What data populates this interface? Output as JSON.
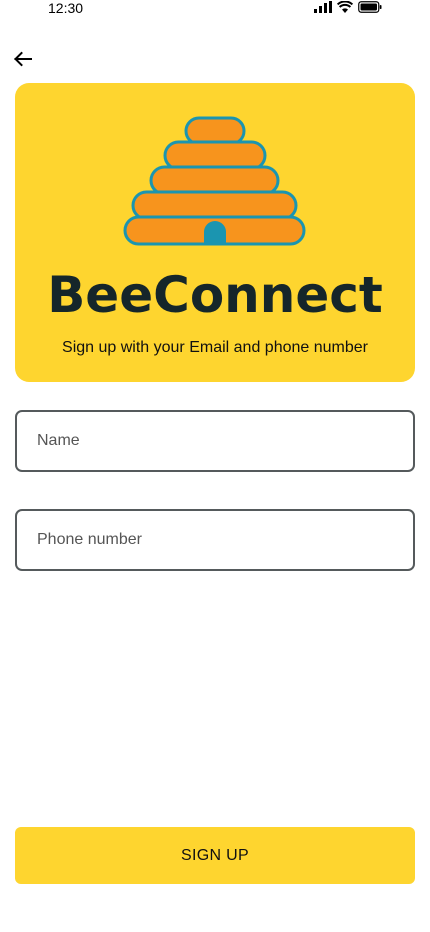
{
  "status_bar": {
    "time": "12:30",
    "icons": [
      "signal-icon",
      "wifi-icon",
      "battery-icon"
    ]
  },
  "nav": {
    "back_icon": "arrow-left-icon"
  },
  "hero": {
    "logo": "beehive-icon",
    "brand": "BeeConnect",
    "tagline": "Sign up with your Email and phone number",
    "colors": {
      "card_background": "#FED52F",
      "hive_fill": "#F7941D",
      "hive_outline": "#1B95B0",
      "brand_text": "#15262A"
    }
  },
  "form": {
    "name_placeholder": "Name",
    "name_value": "",
    "phone_placeholder": "Phone number",
    "phone_value": ""
  },
  "actions": {
    "signup_label": "SIGN UP",
    "button_color": "#FED52F"
  }
}
